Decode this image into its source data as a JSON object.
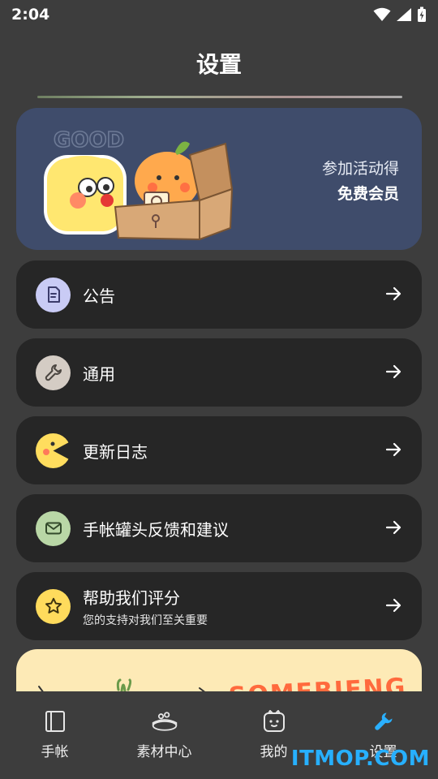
{
  "status_bar": {
    "time": "2:04"
  },
  "header": {
    "title": "设置"
  },
  "banner": {
    "line1": "参加活动得",
    "line2": "免费会员",
    "artwork_text": "GOOD"
  },
  "menu": [
    {
      "label": "公告",
      "icon": "document-icon",
      "icon_bg": "#c9cbf5"
    },
    {
      "label": "通用",
      "icon": "wrench-icon",
      "icon_bg": "#d4ccc4"
    },
    {
      "label": "更新日志",
      "icon": "pacman-icon",
      "icon_bg": "#ffdd5e"
    },
    {
      "label": "手帐罐头反馈和建议",
      "icon": "mail-icon",
      "icon_bg": "#b9d7a6"
    },
    {
      "label": "帮助我们评分",
      "sublabel": "您的支持对我们至关重要",
      "icon": "star-icon",
      "icon_bg": "#ffdb5c"
    }
  ],
  "bottom_card": {
    "artwork_text": "SOMEBIENG"
  },
  "nav": [
    {
      "label": "手帐",
      "icon": "notebook-icon"
    },
    {
      "label": "素材中心",
      "icon": "materials-icon"
    },
    {
      "label": "我的",
      "icon": "face-icon"
    },
    {
      "label": "设置",
      "icon": "wrench-icon",
      "active_color": "#2ab0ff"
    }
  ],
  "watermark": "ITMOP.COM"
}
